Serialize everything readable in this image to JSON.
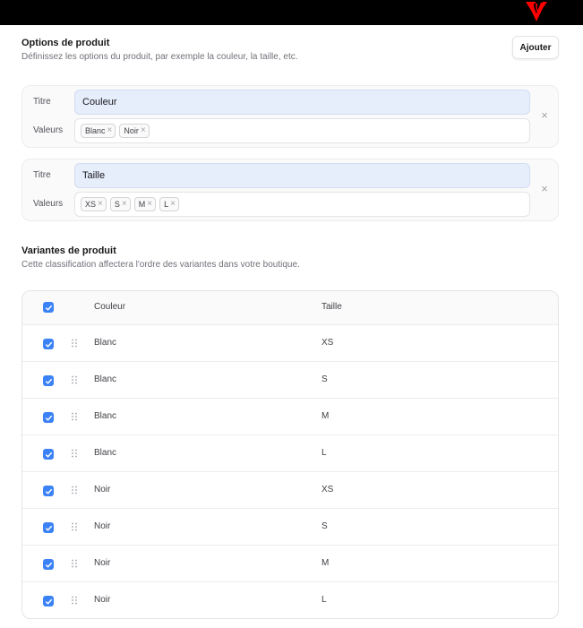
{
  "options_section": {
    "title": "Options de produit",
    "subtitle": "Définissez les options du produit, par exemple la couleur, la taille, etc.",
    "add_label": "Ajouter"
  },
  "options": [
    {
      "title_label": "Titre",
      "title_value": "Couleur",
      "values_label": "Valeurs",
      "values": [
        "Blanc",
        "Noir"
      ]
    },
    {
      "title_label": "Titre",
      "title_value": "Taille",
      "values_label": "Valeurs",
      "values": [
        "XS",
        "S",
        "M",
        "L"
      ]
    }
  ],
  "variants_section": {
    "title": "Variantes de produit",
    "subtitle": "Cette classification affectera l'ordre des variantes dans votre boutique."
  },
  "table": {
    "headers": [
      "Couleur",
      "Taille"
    ],
    "rows": [
      [
        "Blanc",
        "XS"
      ],
      [
        "Blanc",
        "S"
      ],
      [
        "Blanc",
        "M"
      ],
      [
        "Blanc",
        "L"
      ],
      [
        "Noir",
        "XS"
      ],
      [
        "Noir",
        "S"
      ],
      [
        "Noir",
        "M"
      ],
      [
        "Noir",
        "L"
      ]
    ],
    "all_checked": true
  },
  "colors": {
    "accent": "#3b82f6",
    "title_input_bg": "#e6edfb",
    "cursor": "#ff0000"
  }
}
